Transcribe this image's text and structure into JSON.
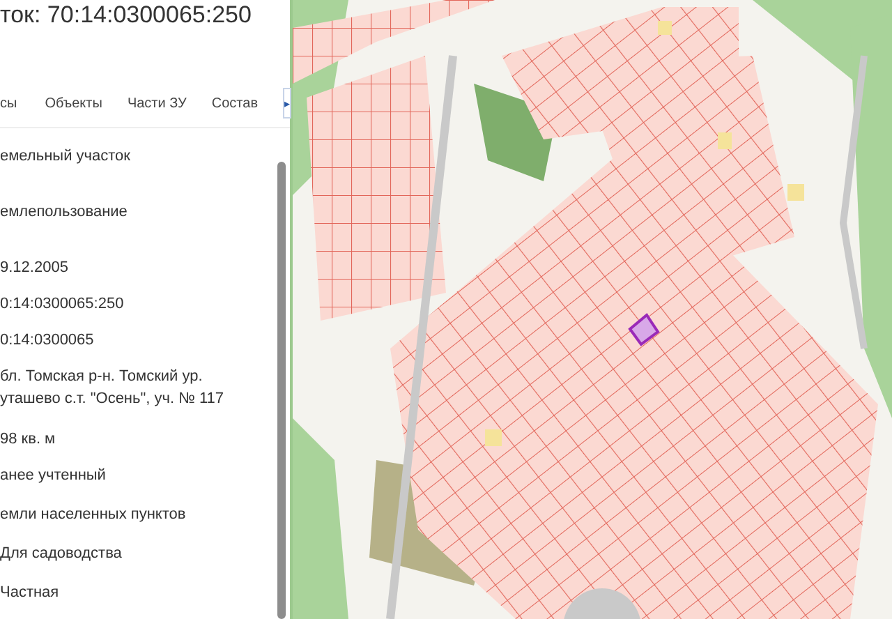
{
  "panel": {
    "title": "ток: 70:14:0300065:250",
    "tabs": [
      {
        "label": "сы",
        "selected": false
      },
      {
        "label": "Объекты",
        "selected": false
      },
      {
        "label": "Части ЗУ",
        "selected": false
      },
      {
        "label": "Состав",
        "selected": false
      }
    ],
    "tabs_next": "▸",
    "fields": [
      {
        "value": "емельный участок"
      },
      {
        "value": "емлепользование"
      },
      {
        "value": "9.12.2005"
      },
      {
        "value": "0:14:0300065:250"
      },
      {
        "value": "0:14:0300065"
      },
      {
        "value": "бл. Томская р-н. Томский ур. уташево с.т. \"Осень\", уч. № 117"
      },
      {
        "value": "98 кв. м"
      },
      {
        "value": "анее учтенный"
      },
      {
        "value": "емли населенных пунктов"
      },
      {
        "value": "Для садоводства"
      },
      {
        "value": "Частная"
      }
    ]
  }
}
